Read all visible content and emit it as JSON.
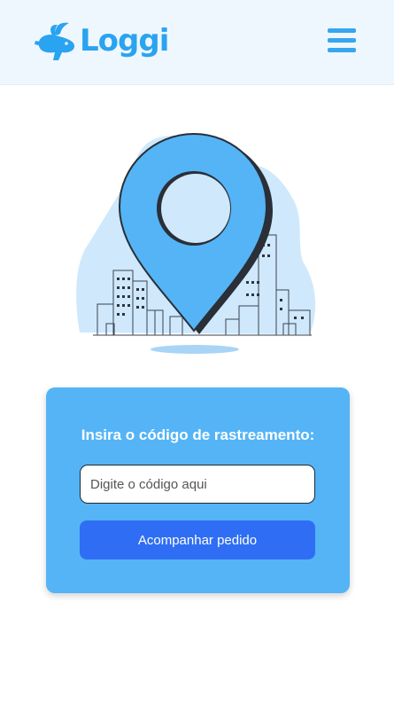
{
  "header": {
    "brand": "Loggi",
    "brand_color": "#2aa3f0",
    "logo_icon": "rabbit-icon",
    "menu_icon": "hamburger-menu-icon"
  },
  "hero": {
    "illustration_icon": "location-pin-city-illustration"
  },
  "tracking": {
    "title": "Insira o código de rastreamento:",
    "input_placeholder": "Digite o código aqui",
    "input_value": "",
    "button_label": "Acompanhar pedido",
    "card_color": "#54b4f6",
    "button_color": "#2f6ef4"
  }
}
